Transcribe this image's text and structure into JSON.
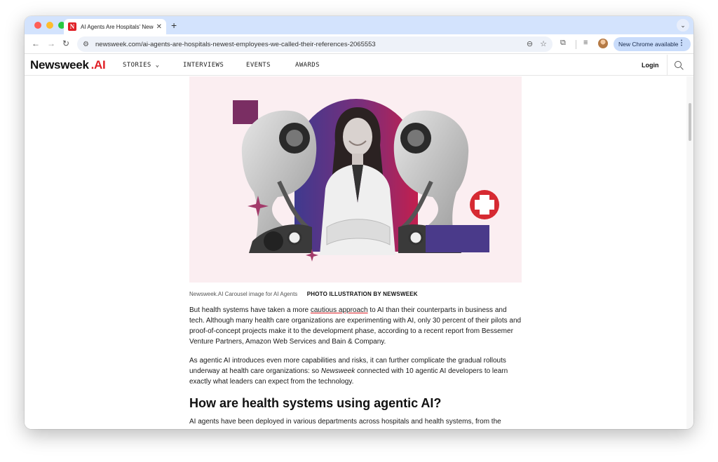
{
  "browser": {
    "tab_title": "AI Agents Are Hospitals' Newest Employees. We Called Their References",
    "favicon_letter": "N",
    "new_tab_glyph": "+",
    "url": "newsweek.com/ai-agents-are-hospitals-newest-employees-we-called-their-references-2065553",
    "update_label": "New Chrome available"
  },
  "site": {
    "logo_main": "Newsweek",
    "logo_ai": ".AI",
    "nav": {
      "stories": "STORIES",
      "interviews": "INTERVIEWS",
      "events": "EVENTS",
      "awards": "AWARDS"
    },
    "login": "Login"
  },
  "article": {
    "caption": "Newsweek.AI Carousel image for AI Agents",
    "credit": "PHOTO ILLUSTRATION BY NEWSWEEK",
    "p1_before": "But health systems have taken a more ",
    "p1_link": "cautious approach",
    "p1_after": " to AI than their counterparts in business and tech. Although many health care organizations are experimenting with AI, only 30 percent of their pilots and proof-of-concept projects make it to the development phase, according to a recent report from Bessemer Venture Partners, Amazon Web Services and Bain & Company.",
    "p2_before": "As agentic AI introduces even more capabilities and risks, it can further complicate the gradual rollouts underway at health care organizations: so ",
    "p2_em": "Newsweek",
    "p2_after": " connected with 10 agentic AI developers to learn exactly what leaders can expect from the technology.",
    "heading": "How are health systems using agentic AI?",
    "p3": "AI agents have been deployed in various departments across hospitals and health systems, from the"
  },
  "icons": {
    "back": "back-arrow-icon",
    "forward": "forward-arrow-icon",
    "reload": "reload-icon",
    "site_info": "tune-icon",
    "zoom": "zoom-icon",
    "bookmark": "star-icon",
    "extensions": "puzzle-icon",
    "media": "media-queue-icon",
    "search": "search-icon"
  },
  "colors": {
    "tabstrip": "#d3e3fd",
    "brand_red": "#e01f26",
    "hero_purple": "#4a3a8a",
    "hero_magenta": "#b01f5a",
    "hero_plum": "#7a2e63"
  }
}
